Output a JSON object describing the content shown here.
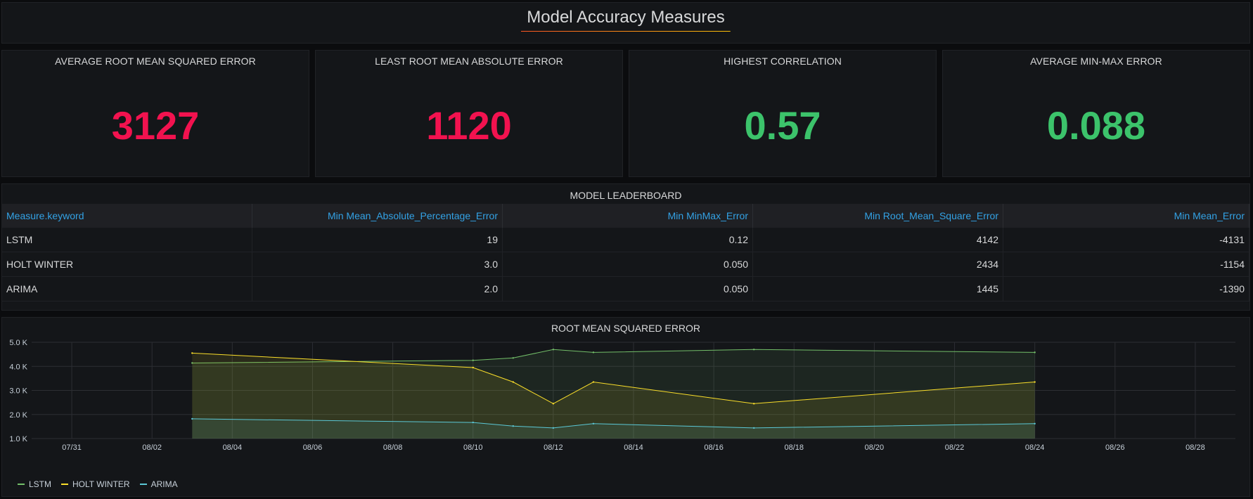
{
  "dashboard": {
    "title": "Model Accuracy Measures"
  },
  "stats": [
    {
      "title": "AVERAGE ROOT MEAN SQUARED ERROR",
      "value": "3127",
      "color": "#f2124f"
    },
    {
      "title": "LEAST ROOT MEAN ABSOLUTE ERROR",
      "value": "1120",
      "color": "#f2124f"
    },
    {
      "title": "HIGHEST CORRELATION",
      "value": "0.57",
      "color": "#3cc36b"
    },
    {
      "title": "AVERAGE MIN-MAX ERROR",
      "value": "0.088",
      "color": "#3cc36b"
    }
  ],
  "leaderboard": {
    "title": "MODEL LEADERBOARD",
    "columns": [
      "Measure.keyword",
      "Min Mean_Absolute_Percentage_Error",
      "Min MinMax_Error",
      "Min Root_Mean_Square_Error",
      "Min Mean_Error"
    ],
    "rows": [
      [
        "LSTM",
        "19",
        "0.12",
        "4142",
        "-4131"
      ],
      [
        "HOLT WINTER",
        "3.0",
        "0.050",
        "2434",
        "-1154"
      ],
      [
        "ARIMA",
        "2.0",
        "0.050",
        "1445",
        "-1390"
      ]
    ]
  },
  "chart_data": {
    "type": "area",
    "title": "ROOT MEAN SQUARED ERROR",
    "x_ticks": [
      "07/31",
      "08/02",
      "08/04",
      "08/06",
      "08/08",
      "08/10",
      "08/12",
      "08/14",
      "08/16",
      "08/18",
      "08/20",
      "08/22",
      "08/24",
      "08/26",
      "08/28"
    ],
    "y_ticks": [
      "1.0 K",
      "2.0 K",
      "3.0 K",
      "4.0 K",
      "5.0 K"
    ],
    "ylim": [
      1000,
      5000
    ],
    "x_range": [
      "07/30",
      "08/29"
    ],
    "grid": true,
    "legend_position": "bottom-left",
    "series": [
      {
        "name": "LSTM",
        "color": "#73bf69",
        "points": [
          [
            "08/03",
            4140
          ],
          [
            "08/10",
            4250
          ],
          [
            "08/11",
            4350
          ],
          [
            "08/12",
            4700
          ],
          [
            "08/13",
            4580
          ],
          [
            "08/17",
            4700
          ],
          [
            "08/24",
            4580
          ]
        ]
      },
      {
        "name": "HOLT WINTER",
        "color": "#fade2a",
        "points": [
          [
            "08/03",
            4550
          ],
          [
            "08/10",
            3950
          ],
          [
            "08/11",
            3350
          ],
          [
            "08/12",
            2450
          ],
          [
            "08/13",
            3350
          ],
          [
            "08/17",
            2450
          ],
          [
            "08/24",
            3350
          ]
        ]
      },
      {
        "name": "ARIMA",
        "color": "#5bc8d6",
        "points": [
          [
            "08/03",
            1820
          ],
          [
            "08/10",
            1670
          ],
          [
            "08/11",
            1520
          ],
          [
            "08/12",
            1440
          ],
          [
            "08/13",
            1620
          ],
          [
            "08/17",
            1440
          ],
          [
            "08/24",
            1620
          ]
        ]
      }
    ]
  }
}
